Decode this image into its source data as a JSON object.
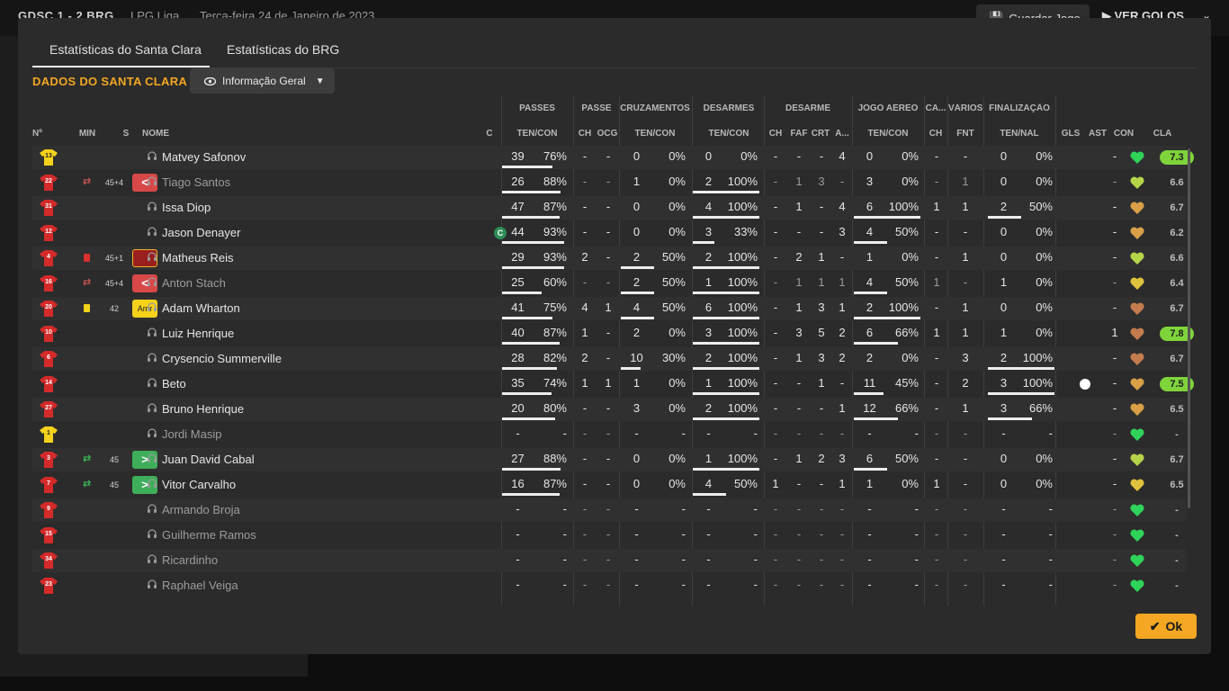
{
  "background": {
    "score": "GDSC  1 - 2  BRG",
    "league": "LPG Liga",
    "date": "Terça-feira 24 de Janeiro de 2023",
    "save_label": "Guardar Jogo",
    "goals_label": "VER GOLOS"
  },
  "tabs": [
    {
      "label": "Estatísticas do Santa Clara",
      "active": true
    },
    {
      "label": "Estatísticas do BRG",
      "active": false
    }
  ],
  "section_title": "DADOS DO SANTA CLARA",
  "view_dropdown": {
    "label": "Informação Geral",
    "icon": "eye-icon"
  },
  "group_headers": [
    "PASSES",
    "PASSE",
    "CRUZAMENTOS",
    "DESARMES",
    "DESARME",
    "JOGO AÉREO",
    "CA...",
    "VÁRIOS",
    "FINALIZAÇÃO"
  ],
  "columns": [
    "Nº",
    "MIN",
    "S",
    "NOME",
    "C",
    "TEN/CON",
    "CH",
    "OCG",
    "TEN/CON",
    "TEN/CON",
    "CH",
    "FAF",
    "CRT",
    "A...",
    "TEN/CON",
    "CH",
    "FNT",
    "TEN/NAL",
    "GLS",
    "AST",
    "CON",
    "CLA"
  ],
  "colors": {
    "accent": "#f3a723",
    "shirt_red": "#d42a2a",
    "shirt_gk": "#f5d21b",
    "rating_high": "#7fd33b",
    "heart_green": "#2fd35a",
    "heart_lime": "#b6d44a",
    "heart_yellow": "#e0c33c",
    "heart_orange": "#d9a048",
    "heart_brown": "#c47c4e"
  },
  "players": [
    {
      "num": "13",
      "gk": true,
      "min": "",
      "sub": "",
      "card": "",
      "status": "",
      "status_kind": "",
      "name": "Matvey Safonov",
      "sub_player": false,
      "capt": false,
      "p_ten": "39",
      "p_pct": "76%",
      "p_frac": 0.76,
      "ch": "-",
      "ocg": "-",
      "cr_ten": "0",
      "cr_pct": "0%",
      "cr_frac": 0,
      "de_ten": "0",
      "de_pct": "0%",
      "de_frac": 0,
      "d_ch": "-",
      "faf": "-",
      "crt": "-",
      "a": "4",
      "ja_ten": "0",
      "ja_pct": "0%",
      "ja_frac": 0,
      "ca": "-",
      "fnt": "-",
      "fi_ten": "0",
      "fi_pct": "0%",
      "fi_frac": 0,
      "gls": "",
      "ast": "-",
      "con": "heart_green",
      "cla": "7.3",
      "cla_high": true
    },
    {
      "num": "22",
      "gk": false,
      "min": "45+4",
      "sub": "off",
      "card": "",
      "status": "<",
      "status_kind": "off",
      "name": "Tiago Santos",
      "sub_player": true,
      "capt": false,
      "p_ten": "26",
      "p_pct": "88%",
      "p_frac": 0.88,
      "ch": "-",
      "ocg": "-",
      "cr_ten": "1",
      "cr_pct": "0%",
      "cr_frac": 0,
      "de_ten": "2",
      "de_pct": "100%",
      "de_frac": 1,
      "d_ch": "-",
      "faf": "1",
      "crt": "3",
      "a": "-",
      "ja_ten": "3",
      "ja_pct": "0%",
      "ja_frac": 0,
      "ca": "-",
      "fnt": "1",
      "fi_ten": "0",
      "fi_pct": "0%",
      "fi_frac": 0,
      "gls": "",
      "ast": "-",
      "con": "heart_lime",
      "cla": "6.6",
      "cla_high": false
    },
    {
      "num": "31",
      "gk": false,
      "min": "",
      "sub": "",
      "card": "",
      "status": "",
      "status_kind": "",
      "name": "Issa Diop",
      "sub_player": false,
      "capt": false,
      "p_ten": "47",
      "p_pct": "87%",
      "p_frac": 0.87,
      "ch": "-",
      "ocg": "-",
      "cr_ten": "0",
      "cr_pct": "0%",
      "cr_frac": 0,
      "de_ten": "4",
      "de_pct": "100%",
      "de_frac": 1,
      "d_ch": "-",
      "faf": "1",
      "crt": "-",
      "a": "4",
      "ja_ten": "6",
      "ja_pct": "100%",
      "ja_frac": 1,
      "ca": "1",
      "fnt": "1",
      "fi_ten": "2",
      "fi_pct": "50%",
      "fi_frac": 0.5,
      "gls": "",
      "ast": "-",
      "con": "heart_orange",
      "cla": "6.7",
      "cla_high": false
    },
    {
      "num": "12",
      "gk": false,
      "min": "",
      "sub": "",
      "card": "",
      "status": "",
      "status_kind": "",
      "name": "Jason Denayer",
      "sub_player": false,
      "capt": true,
      "p_ten": "44",
      "p_pct": "93%",
      "p_frac": 0.93,
      "ch": "-",
      "ocg": "-",
      "cr_ten": "0",
      "cr_pct": "0%",
      "cr_frac": 0,
      "de_ten": "3",
      "de_pct": "33%",
      "de_frac": 0.33,
      "d_ch": "-",
      "faf": "-",
      "crt": "-",
      "a": "3",
      "ja_ten": "4",
      "ja_pct": "50%",
      "ja_frac": 0.5,
      "ca": "-",
      "fnt": "-",
      "fi_ten": "0",
      "fi_pct": "0%",
      "fi_frac": 0,
      "gls": "",
      "ast": "-",
      "con": "heart_orange",
      "cla": "6.2",
      "cla_high": false
    },
    {
      "num": "4",
      "gk": false,
      "min": "45+1",
      "sub": "",
      "card": "red",
      "status": "",
      "status_kind": "red",
      "name": "Matheus Reis",
      "sub_player": false,
      "capt": false,
      "p_ten": "29",
      "p_pct": "93%",
      "p_frac": 0.93,
      "ch": "2",
      "ocg": "-",
      "cr_ten": "2",
      "cr_pct": "50%",
      "cr_frac": 0.5,
      "de_ten": "2",
      "de_pct": "100%",
      "de_frac": 1,
      "d_ch": "-",
      "faf": "2",
      "crt": "1",
      "a": "-",
      "ja_ten": "1",
      "ja_pct": "0%",
      "ja_frac": 0,
      "ca": "-",
      "fnt": "1",
      "fi_ten": "0",
      "fi_pct": "0%",
      "fi_frac": 0,
      "gls": "",
      "ast": "-",
      "con": "heart_lime",
      "cla": "6.6",
      "cla_high": false
    },
    {
      "num": "16",
      "gk": false,
      "min": "45+4",
      "sub": "off",
      "card": "",
      "status": "<",
      "status_kind": "off",
      "name": "Anton Stach",
      "sub_player": true,
      "capt": false,
      "p_ten": "25",
      "p_pct": "60%",
      "p_frac": 0.6,
      "ch": "-",
      "ocg": "-",
      "cr_ten": "2",
      "cr_pct": "50%",
      "cr_frac": 0.5,
      "de_ten": "1",
      "de_pct": "100%",
      "de_frac": 1,
      "d_ch": "-",
      "faf": "1",
      "crt": "1",
      "a": "1",
      "ja_ten": "4",
      "ja_pct": "50%",
      "ja_frac": 0.5,
      "ca": "1",
      "fnt": "-",
      "fi_ten": "1",
      "fi_pct": "0%",
      "fi_frac": 0,
      "gls": "",
      "ast": "-",
      "con": "heart_yellow",
      "cla": "6.4",
      "cla_high": false
    },
    {
      "num": "20",
      "gk": false,
      "min": "42",
      "sub": "",
      "card": "yellow",
      "status": "Amr",
      "status_kind": "yellow",
      "name": "Adam Wharton",
      "sub_player": false,
      "capt": false,
      "p_ten": "41",
      "p_pct": "75%",
      "p_frac": 0.75,
      "ch": "4",
      "ocg": "1",
      "cr_ten": "4",
      "cr_pct": "50%",
      "cr_frac": 0.5,
      "de_ten": "6",
      "de_pct": "100%",
      "de_frac": 1,
      "d_ch": "-",
      "faf": "1",
      "crt": "3",
      "a": "1",
      "ja_ten": "2",
      "ja_pct": "100%",
      "ja_frac": 1,
      "ca": "-",
      "fnt": "1",
      "fi_ten": "0",
      "fi_pct": "0%",
      "fi_frac": 0,
      "gls": "",
      "ast": "-",
      "con": "heart_brown",
      "cla": "6.7",
      "cla_high": false
    },
    {
      "num": "10",
      "gk": false,
      "min": "",
      "sub": "",
      "card": "",
      "status": "",
      "status_kind": "",
      "name": "Luiz Henrique",
      "sub_player": false,
      "capt": false,
      "p_ten": "40",
      "p_pct": "87%",
      "p_frac": 0.87,
      "ch": "1",
      "ocg": "-",
      "cr_ten": "2",
      "cr_pct": "0%",
      "cr_frac": 0,
      "de_ten": "3",
      "de_pct": "100%",
      "de_frac": 1,
      "d_ch": "-",
      "faf": "3",
      "crt": "5",
      "a": "2",
      "ja_ten": "6",
      "ja_pct": "66%",
      "ja_frac": 0.66,
      "ca": "1",
      "fnt": "1",
      "fi_ten": "1",
      "fi_pct": "0%",
      "fi_frac": 0,
      "gls": "",
      "ast": "1",
      "con": "heart_brown",
      "cla": "7.8",
      "cla_high": true
    },
    {
      "num": "6",
      "gk": false,
      "min": "",
      "sub": "",
      "card": "",
      "status": "",
      "status_kind": "",
      "name": "Crysencio Summerville",
      "sub_player": false,
      "capt": false,
      "p_ten": "28",
      "p_pct": "82%",
      "p_frac": 0.82,
      "ch": "2",
      "ocg": "-",
      "cr_ten": "10",
      "cr_pct": "30%",
      "cr_frac": 0.3,
      "de_ten": "2",
      "de_pct": "100%",
      "de_frac": 1,
      "d_ch": "-",
      "faf": "1",
      "crt": "3",
      "a": "2",
      "ja_ten": "2",
      "ja_pct": "0%",
      "ja_frac": 0,
      "ca": "-",
      "fnt": "3",
      "fi_ten": "2",
      "fi_pct": "100%",
      "fi_frac": 1,
      "gls": "",
      "ast": "-",
      "con": "heart_brown",
      "cla": "6.7",
      "cla_high": false
    },
    {
      "num": "14",
      "gk": false,
      "min": "",
      "sub": "",
      "card": "",
      "status": "",
      "status_kind": "",
      "name": "Beto",
      "sub_player": false,
      "capt": false,
      "p_ten": "35",
      "p_pct": "74%",
      "p_frac": 0.74,
      "ch": "1",
      "ocg": "1",
      "cr_ten": "1",
      "cr_pct": "0%",
      "cr_frac": 0,
      "de_ten": "1",
      "de_pct": "100%",
      "de_frac": 1,
      "d_ch": "-",
      "faf": "-",
      "crt": "1",
      "a": "-",
      "ja_ten": "11",
      "ja_pct": "45%",
      "ja_frac": 0.45,
      "ca": "-",
      "fnt": "2",
      "fi_ten": "3",
      "fi_pct": "100%",
      "fi_frac": 1,
      "gls": "ball",
      "ast": "-",
      "con": "heart_orange",
      "cla": "7.5",
      "cla_high": true
    },
    {
      "num": "27",
      "gk": false,
      "min": "",
      "sub": "",
      "card": "",
      "status": "",
      "status_kind": "",
      "name": "Bruno Henrique",
      "sub_player": false,
      "capt": false,
      "p_ten": "20",
      "p_pct": "80%",
      "p_frac": 0.8,
      "ch": "-",
      "ocg": "-",
      "cr_ten": "3",
      "cr_pct": "0%",
      "cr_frac": 0,
      "de_ten": "2",
      "de_pct": "100%",
      "de_frac": 1,
      "d_ch": "-",
      "faf": "-",
      "crt": "-",
      "a": "1",
      "ja_ten": "12",
      "ja_pct": "66%",
      "ja_frac": 0.66,
      "ca": "-",
      "fnt": "1",
      "fi_ten": "3",
      "fi_pct": "66%",
      "fi_frac": 0.66,
      "gls": "",
      "ast": "-",
      "con": "heart_orange",
      "cla": "6.5",
      "cla_high": false
    },
    {
      "num": "1",
      "gk": true,
      "min": "",
      "sub": "",
      "card": "",
      "status": "",
      "status_kind": "",
      "name": "Jordi Masip",
      "sub_player": true,
      "capt": false,
      "p_ten": "-",
      "p_pct": "-",
      "p_frac": null,
      "ch": "-",
      "ocg": "-",
      "cr_ten": "-",
      "cr_pct": "-",
      "cr_frac": null,
      "de_ten": "-",
      "de_pct": "-",
      "de_frac": null,
      "d_ch": "-",
      "faf": "-",
      "crt": "-",
      "a": "-",
      "ja_ten": "-",
      "ja_pct": "-",
      "ja_frac": null,
      "ca": "-",
      "fnt": "-",
      "fi_ten": "-",
      "fi_pct": "-",
      "fi_frac": null,
      "gls": "",
      "ast": "-",
      "con": "heart_green",
      "cla": "-",
      "cla_high": false
    },
    {
      "num": "3",
      "gk": false,
      "min": "45",
      "sub": "on",
      "card": "",
      "status": ">",
      "status_kind": "on",
      "name": "Juan David Cabal",
      "sub_player": false,
      "capt": false,
      "p_ten": "27",
      "p_pct": "88%",
      "p_frac": 0.88,
      "ch": "-",
      "ocg": "-",
      "cr_ten": "0",
      "cr_pct": "0%",
      "cr_frac": 0,
      "de_ten": "1",
      "de_pct": "100%",
      "de_frac": 1,
      "d_ch": "-",
      "faf": "1",
      "crt": "2",
      "a": "3",
      "ja_ten": "6",
      "ja_pct": "50%",
      "ja_frac": 0.5,
      "ca": "-",
      "fnt": "-",
      "fi_ten": "0",
      "fi_pct": "0%",
      "fi_frac": 0,
      "gls": "",
      "ast": "-",
      "con": "heart_lime",
      "cla": "6.7",
      "cla_high": false
    },
    {
      "num": "7",
      "gk": false,
      "min": "45",
      "sub": "on",
      "card": "",
      "status": ">",
      "status_kind": "on",
      "name": "Vitor Carvalho",
      "sub_player": false,
      "capt": false,
      "p_ten": "16",
      "p_pct": "87%",
      "p_frac": 0.87,
      "ch": "-",
      "ocg": "-",
      "cr_ten": "0",
      "cr_pct": "0%",
      "cr_frac": 0,
      "de_ten": "4",
      "de_pct": "50%",
      "de_frac": 0.5,
      "d_ch": "1",
      "faf": "-",
      "crt": "-",
      "a": "1",
      "ja_ten": "1",
      "ja_pct": "0%",
      "ja_frac": 0,
      "ca": "1",
      "fnt": "-",
      "fi_ten": "0",
      "fi_pct": "0%",
      "fi_frac": 0,
      "gls": "",
      "ast": "-",
      "con": "heart_yellow",
      "cla": "6.5",
      "cla_high": false
    },
    {
      "num": "9",
      "gk": false,
      "min": "",
      "sub": "",
      "card": "",
      "status": "",
      "status_kind": "",
      "name": "Armando Broja",
      "sub_player": true,
      "capt": false,
      "p_ten": "-",
      "p_pct": "-",
      "p_frac": null,
      "ch": "-",
      "ocg": "-",
      "cr_ten": "-",
      "cr_pct": "-",
      "cr_frac": null,
      "de_ten": "-",
      "de_pct": "-",
      "de_frac": null,
      "d_ch": "-",
      "faf": "-",
      "crt": "-",
      "a": "-",
      "ja_ten": "-",
      "ja_pct": "-",
      "ja_frac": null,
      "ca": "-",
      "fnt": "-",
      "fi_ten": "-",
      "fi_pct": "-",
      "fi_frac": null,
      "gls": "",
      "ast": "-",
      "con": "heart_green",
      "cla": "-",
      "cla_high": false
    },
    {
      "num": "15",
      "gk": false,
      "min": "",
      "sub": "",
      "card": "",
      "status": "",
      "status_kind": "",
      "name": "Guilherme Ramos",
      "sub_player": true,
      "capt": false,
      "p_ten": "-",
      "p_pct": "-",
      "p_frac": null,
      "ch": "-",
      "ocg": "-",
      "cr_ten": "-",
      "cr_pct": "-",
      "cr_frac": null,
      "de_ten": "-",
      "de_pct": "-",
      "de_frac": null,
      "d_ch": "-",
      "faf": "-",
      "crt": "-",
      "a": "-",
      "ja_ten": "-",
      "ja_pct": "-",
      "ja_frac": null,
      "ca": "-",
      "fnt": "-",
      "fi_ten": "-",
      "fi_pct": "-",
      "fi_frac": null,
      "gls": "",
      "ast": "-",
      "con": "heart_green",
      "cla": "-",
      "cla_high": false
    },
    {
      "num": "34",
      "gk": false,
      "min": "",
      "sub": "",
      "card": "",
      "status": "",
      "status_kind": "",
      "name": "Ricardinho",
      "sub_player": true,
      "capt": false,
      "p_ten": "-",
      "p_pct": "-",
      "p_frac": null,
      "ch": "-",
      "ocg": "-",
      "cr_ten": "-",
      "cr_pct": "-",
      "cr_frac": null,
      "de_ten": "-",
      "de_pct": "-",
      "de_frac": null,
      "d_ch": "-",
      "faf": "-",
      "crt": "-",
      "a": "-",
      "ja_ten": "-",
      "ja_pct": "-",
      "ja_frac": null,
      "ca": "-",
      "fnt": "-",
      "fi_ten": "-",
      "fi_pct": "-",
      "fi_frac": null,
      "gls": "",
      "ast": "-",
      "con": "heart_green",
      "cla": "-",
      "cla_high": false
    },
    {
      "num": "23",
      "gk": false,
      "min": "",
      "sub": "",
      "card": "",
      "status": "",
      "status_kind": "",
      "name": "Raphael Veiga",
      "sub_player": true,
      "capt": false,
      "p_ten": "-",
      "p_pct": "-",
      "p_frac": null,
      "ch": "-",
      "ocg": "-",
      "cr_ten": "-",
      "cr_pct": "-",
      "cr_frac": null,
      "de_ten": "-",
      "de_pct": "-",
      "de_frac": null,
      "d_ch": "-",
      "faf": "-",
      "crt": "-",
      "a": "-",
      "ja_ten": "-",
      "ja_pct": "-",
      "ja_frac": null,
      "ca": "-",
      "fnt": "-",
      "fi_ten": "-",
      "fi_pct": "-",
      "fi_frac": null,
      "gls": "",
      "ast": "-",
      "con": "heart_green",
      "cla": "-",
      "cla_high": false
    }
  ],
  "captain_badge": "C",
  "ok_label": "Ok"
}
